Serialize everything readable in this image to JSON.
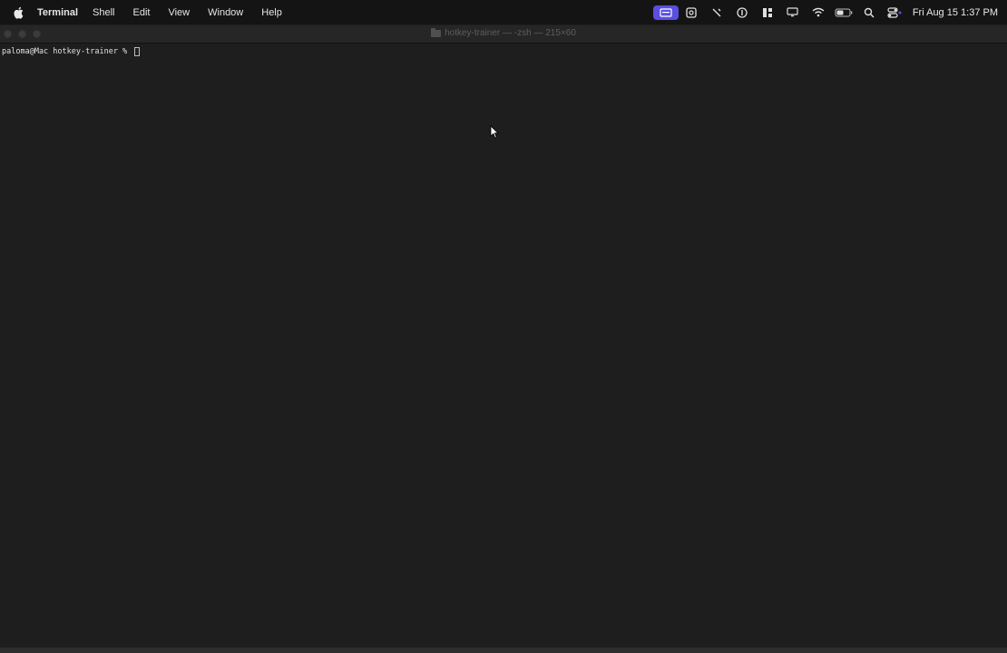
{
  "menubar": {
    "app_name": "Terminal",
    "items": [
      "Shell",
      "Edit",
      "View",
      "Window",
      "Help"
    ],
    "status_icons": [
      "screen-share-icon",
      "screenshot-icon",
      "tools-icon",
      "one-password-icon",
      "tiles-icon",
      "display-icon",
      "wifi-icon",
      "battery-icon",
      "spotlight-search-icon",
      "control-center-icon"
    ],
    "clock": "Fri Aug 15  1:37 PM",
    "accent_color": "#5b4fe0"
  },
  "window": {
    "title": "hotkey-trainer — -zsh — 215×60"
  },
  "terminal": {
    "prompt": "paloma@Mac hotkey-trainer % "
  }
}
